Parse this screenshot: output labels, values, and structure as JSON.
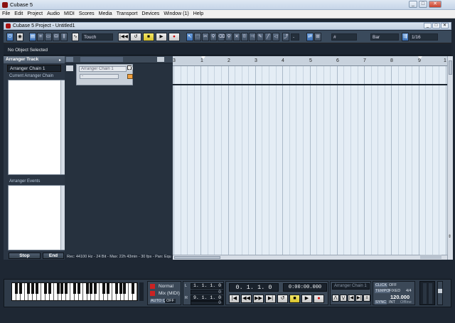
{
  "os_window": {
    "title": "Cubase 5",
    "controls": [
      "_",
      "□",
      "✕"
    ]
  },
  "menu": [
    "File",
    "Edit",
    "Project",
    "Audio",
    "MIDI",
    "Scores",
    "Media",
    "Transport",
    "Devices",
    "Window (1)",
    "Help"
  ],
  "project_window": {
    "title": "Cubase 5 Project - Untitled1",
    "controls": [
      "_",
      "□",
      "✕"
    ]
  },
  "toolbar": {
    "automation_mode": "Touch",
    "snap_type": "Bar",
    "quantize": "1/16",
    "extra_dropdown": "-",
    "transport_buttons": [
      "|◀◀",
      "↺",
      "■",
      "▶",
      "●"
    ]
  },
  "info_line": {
    "text": "No Object Selected"
  },
  "inspector": {
    "header": "Arranger Track",
    "selected_chain": "Arranger Chain 1",
    "current_chain_label": "Current Arranger Chain",
    "events_label": "Arranger Events",
    "stop_label": "Stop",
    "end_label": "End"
  },
  "track": {
    "name": "Arranger Chain 1",
    "sub": "-"
  },
  "ruler": {
    "bars": [
      "1",
      "2",
      "3",
      "4",
      "5",
      "6",
      "7",
      "8",
      "9",
      "1"
    ]
  },
  "status_bar": {
    "text": "Rec: 44100 Hz - 24 Bit - Max: 22h 43min - 30 fps - Pan: Equ"
  },
  "transport": {
    "mode": "Normal",
    "mix_mode": "Mix (MIDI)",
    "auto_q": "AUTO Q",
    "auto_q_value": "OFF",
    "left_locator": "1. 1. 1. 0",
    "left_locator_sub": "0",
    "right_locator": "9. 1. 1. 0",
    "right_locator_sub": "0",
    "position_bars": "0. 1. 1. 0",
    "position_time": "0:00:00.000",
    "arranger_chain": "Arranger Chain 1",
    "click_label": "CLICK",
    "click_value": "OFF",
    "tempo_label": "TEMPO",
    "tempo_mode": "FIXED",
    "signature": "4/4",
    "tempo_value": "120.000",
    "sync_label": "SYNC",
    "sync_value": "INT",
    "sync_status": "Offline",
    "pos_buttons": [
      "|◀",
      "◀◀",
      "▶▶",
      "▶|",
      "↺",
      "■",
      "▶",
      "●"
    ]
  }
}
